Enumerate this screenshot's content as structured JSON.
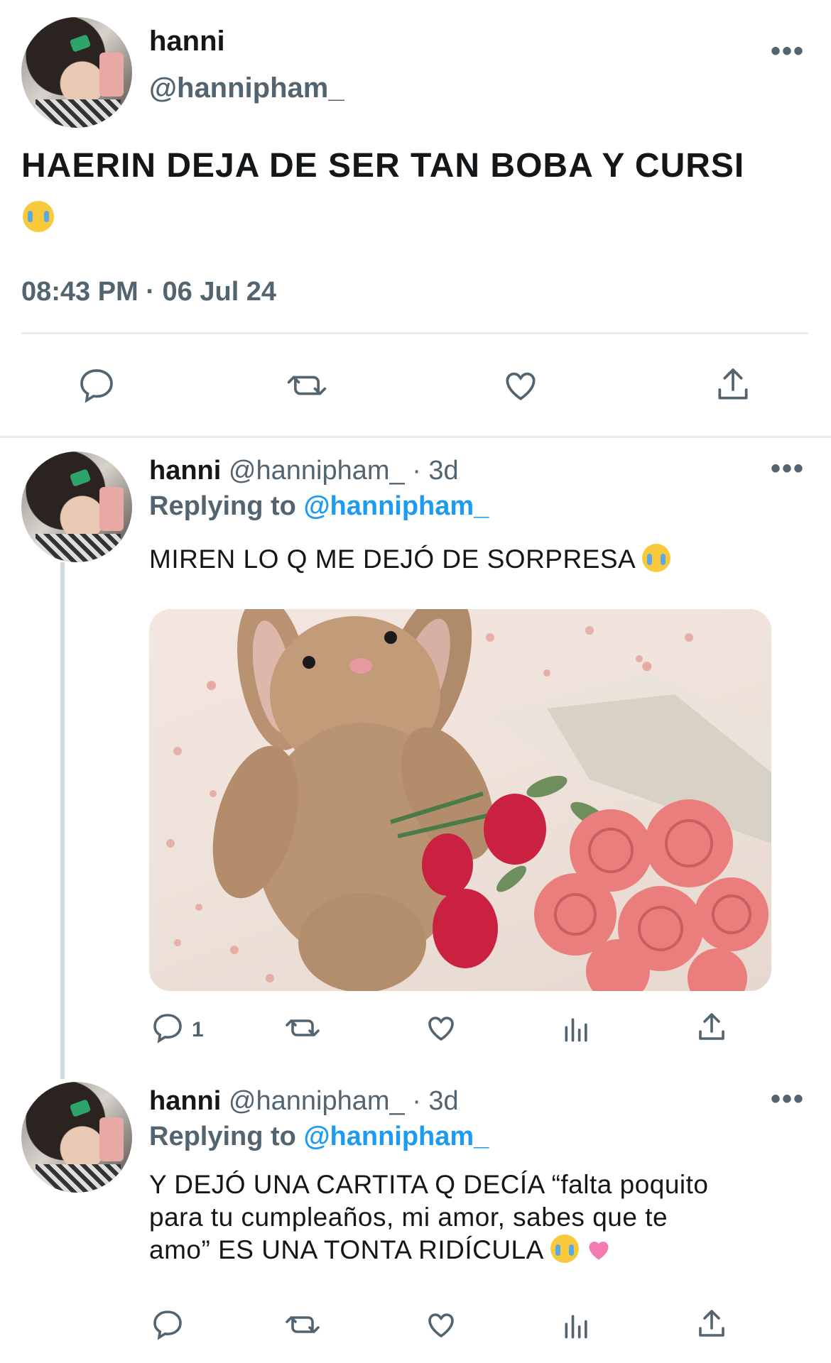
{
  "main_tweet": {
    "name": "hanni",
    "handle": "@hannipham_",
    "text": "HAERIN DEJA DE SER TAN BOBA Y CURSI",
    "time": "08:43 PM · 06 Jul 24"
  },
  "replies": [
    {
      "name": "hanni",
      "handle": "@hannipham_",
      "age": "· 3d",
      "replying_prefix": "Replying to",
      "replying_to": "@hannipham_",
      "text": "MIREN LO Q ME DEJÓ DE SORPRESA",
      "reply_count": "1"
    },
    {
      "name": "hanni",
      "handle": "@hannipham_",
      "age": "· 3d",
      "replying_prefix": "Replying to",
      "replying_to": "@hannipham_",
      "text_line1": "Y DEJÓ UNA CARTITA Q DECÍA “falta poquito",
      "text_line2": "para tu cumpleaños, mi amor, sabes que te",
      "text_line3": "amo” ES UNA TONTA RIDÍCULA"
    }
  ],
  "colors": {
    "accent": "#1d9bf0",
    "muted": "#536471",
    "divider": "#e6ecf0"
  }
}
